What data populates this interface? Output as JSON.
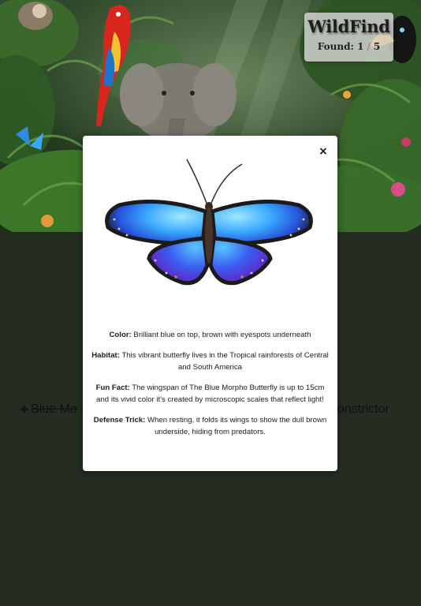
{
  "game": {
    "title": "WildFind",
    "found_label": "Found:",
    "found_count": "1",
    "separator": "/",
    "total_count": "5"
  },
  "checklist": {
    "left_visible": "Blue Mo",
    "right_visible": "onstrictor"
  },
  "modal": {
    "close_symbol": "×",
    "color_label": "Color:",
    "color_text": "Brilliant blue on top, brown with eyespots underneath",
    "habitat_label": "Habitat:",
    "habitat_text": "This vibrant butterfly lives in the Tropical rainforests of Central and South America",
    "funfact_label": "Fun Fact:",
    "funfact_text": "The wingspan of The Blue Morpho Butterfly is up to 15cm and its vivid color it's created by microscopic scales that reflect light!",
    "defense_label": "Defense Trick:",
    "defense_text": "When resting, it folds its wings to show the dull brown underside, hiding from predators."
  },
  "colors": {
    "background": "#252d23",
    "modal_bg": "#ffffff",
    "morpho_blue": "#3aa7ff"
  }
}
